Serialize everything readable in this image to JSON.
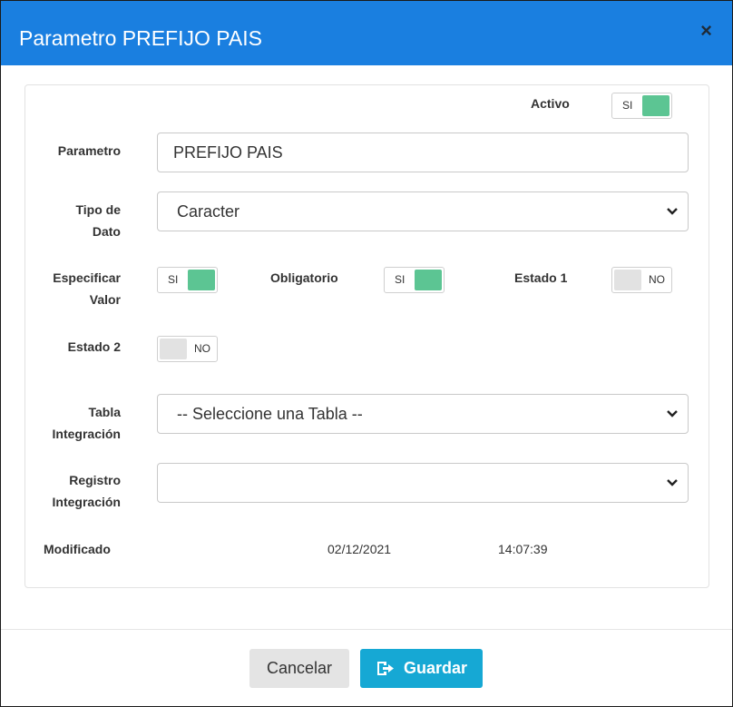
{
  "modal": {
    "title": "Parametro PREFIJO PAIS",
    "close_glyph": "×"
  },
  "form": {
    "activo": {
      "label": "Activo",
      "state": "SI",
      "on": true
    },
    "parametro": {
      "label": "Parametro",
      "value": "PREFIJO PAIS"
    },
    "tipo_dato": {
      "label_line1": "Tipo de",
      "label_line2": "Dato",
      "value": "Caracter"
    },
    "especificar_valor": {
      "label_line1": "Especificar",
      "label_line2": "Valor",
      "state": "SI",
      "on": true
    },
    "obligatorio": {
      "label": "Obligatorio",
      "state": "SI",
      "on": true
    },
    "estado1": {
      "label": "Estado 1",
      "state": "NO",
      "on": false
    },
    "estado2": {
      "label": "Estado 2",
      "state": "NO",
      "on": false
    },
    "tabla_integracion": {
      "label_line1": "Tabla",
      "label_line2": "Integración",
      "value": "-- Seleccione una Tabla --"
    },
    "registro_integracion": {
      "label_line1": "Registro",
      "label_line2": "Integración",
      "value": ""
    },
    "modificado": {
      "label": "Modificado",
      "date": "02/12/2021",
      "time": "14:07:39"
    }
  },
  "footer": {
    "cancel_label": "Cancelar",
    "save_label": "Guardar",
    "save_icon": "save-arrow-icon"
  },
  "colors": {
    "header": "#1a7fe0",
    "toggle_on": "#5cc593",
    "toggle_off": "#e2e2e2",
    "save_button": "#16a8d4",
    "cancel_button": "#e4e4e4"
  }
}
